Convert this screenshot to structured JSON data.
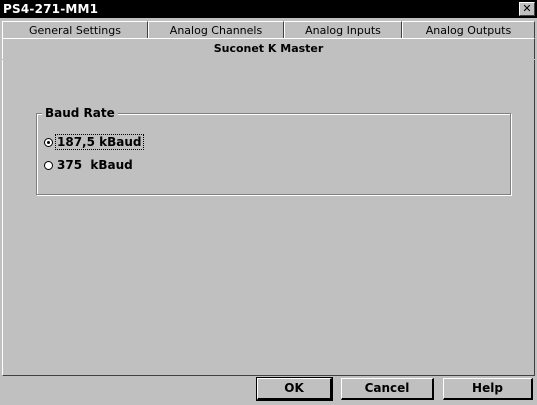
{
  "window": {
    "title": "PS4-271-MM1",
    "close_glyph": "✕"
  },
  "tabs": {
    "row1": [
      "General Settings",
      "Analog Channels",
      "Analog Inputs",
      "Analog Outputs"
    ],
    "active": "Suconet K Master"
  },
  "baud_rate": {
    "title": "Baud Rate",
    "options": [
      {
        "label": "187,5 kBaud",
        "selected": true
      },
      {
        "label": "375  kBaud",
        "selected": false
      }
    ]
  },
  "buttons": {
    "ok": "OK",
    "cancel": "Cancel",
    "help": "Help"
  },
  "icons": {
    "close": "close-icon"
  }
}
